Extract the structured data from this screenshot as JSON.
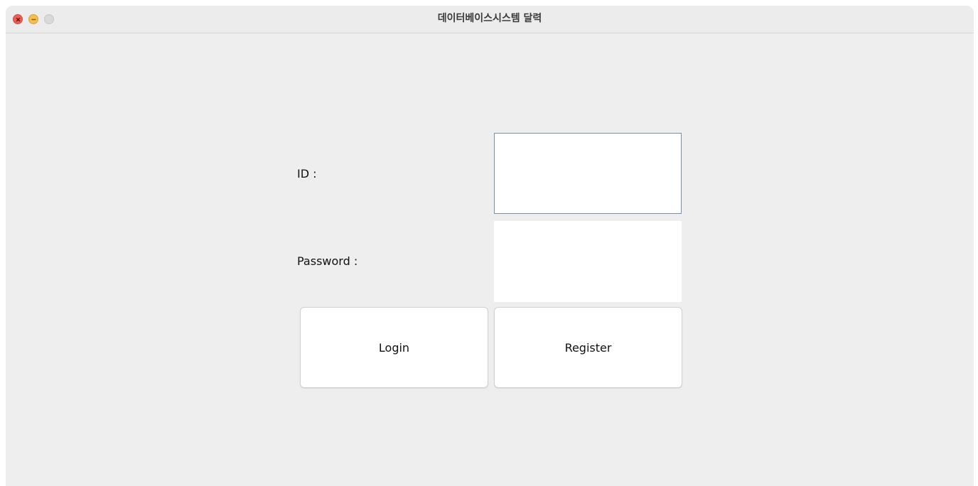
{
  "window": {
    "title": "데이터베이스시스템 달력",
    "controls": {
      "close": "close-icon",
      "minimize": "minimize-icon",
      "zoom": "zoom-icon"
    }
  },
  "form": {
    "id_label": "ID :",
    "id_value": "",
    "password_label": "Password :",
    "password_value": "",
    "login_label": "Login",
    "register_label": "Register"
  },
  "colors": {
    "window_bg": "#eeeeee",
    "field_focus_border": "#7a8ea8",
    "close": "#ec5f57",
    "minimize": "#f5bf4f"
  }
}
